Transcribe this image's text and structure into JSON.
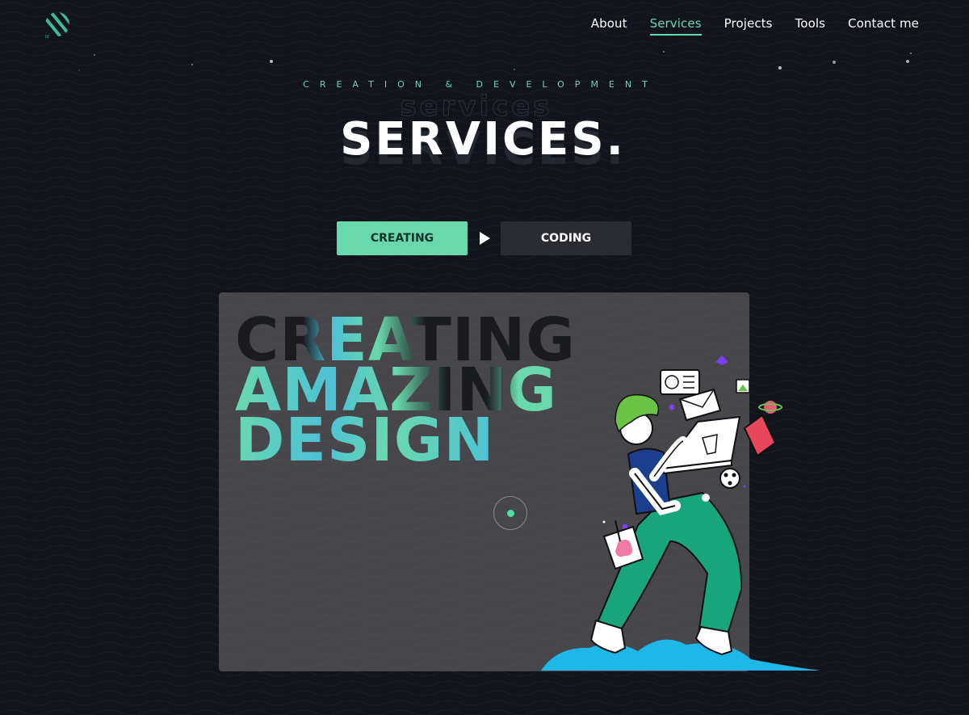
{
  "nav": {
    "items": [
      {
        "label": "About",
        "active": false
      },
      {
        "label": "Services",
        "active": true
      },
      {
        "label": "Projects",
        "active": false
      },
      {
        "label": "Tools",
        "active": false
      },
      {
        "label": "Contact me",
        "active": false
      }
    ]
  },
  "header": {
    "eyebrow": "CREATION & DEVELOPMENT",
    "ghost_title": "services",
    "title": "SERVICES."
  },
  "tabs": {
    "creating": "CREATING",
    "coding": "CODING"
  },
  "card": {
    "hero_line_1": "CREATING",
    "hero_line_2": "AMAZING",
    "hero_line_3": "DESIGN"
  },
  "colors": {
    "background": "#11141b",
    "accent": "#6ad8ad",
    "accent_secondary": "#4cc1d6",
    "card": "#47474b",
    "tab_inactive": "#2a2c32"
  },
  "icons": {
    "logo": "striped-circle-logo-icon",
    "play": "play-icon"
  }
}
